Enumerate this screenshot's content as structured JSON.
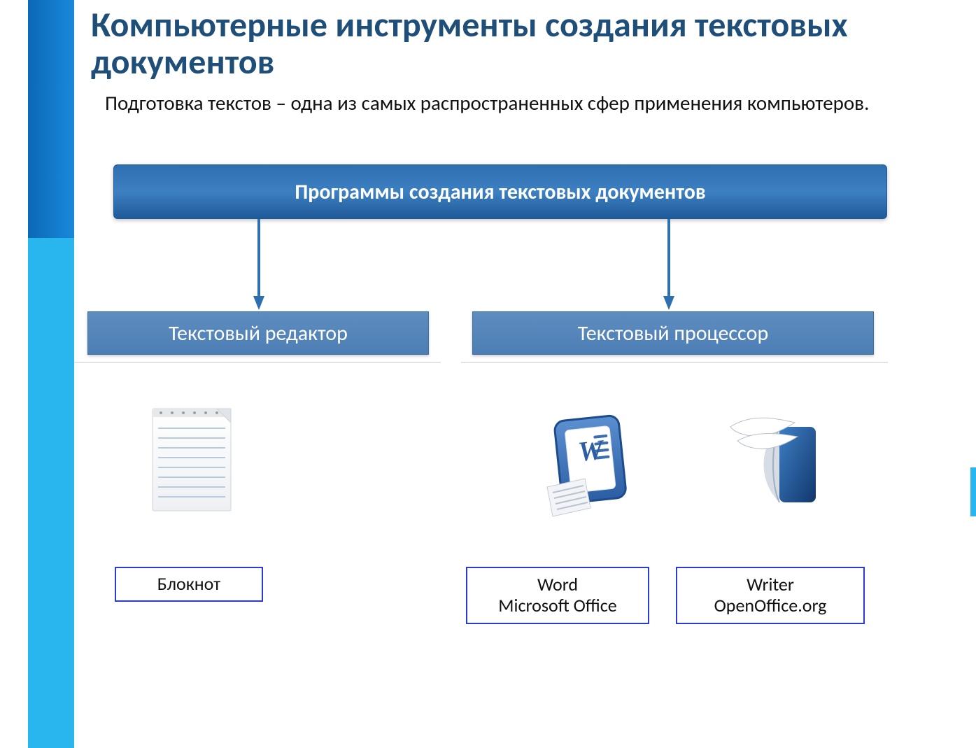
{
  "title": "Компьютерные инструменты создания текстовых документов",
  "lead": "Подготовка текстов – одна из самых распространенных сфер применения компьютеров.",
  "root_label": "Программы создания текстовых документов",
  "editor_label": "Текстовый редактор",
  "processor_label": "Текстовый процессор",
  "apps": {
    "notepad": {
      "line1": "Блокнот"
    },
    "word": {
      "line1": "Word",
      "line2": "Microsoft Office"
    },
    "writer": {
      "line1": "Writer",
      "line2": "OpenOffice.org"
    }
  },
  "icons": {
    "notepad": "notepad-icon",
    "word": "word-icon",
    "writer": "openoffice-icon"
  },
  "colors": {
    "title": "#1f4e79",
    "accent_dark": "#1a88da",
    "accent_light": "#29b6ef",
    "box_root": "#2e6faf",
    "box_child": "#4d7fb5",
    "label_border": "#2b3bcf"
  }
}
